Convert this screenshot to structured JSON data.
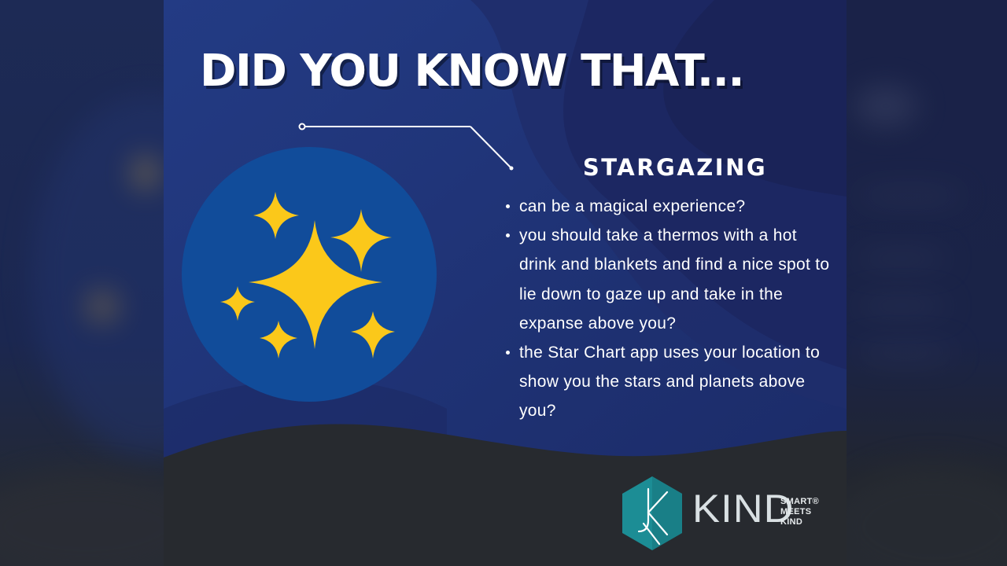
{
  "header": {
    "title": "DID YOU KNOW THAT..."
  },
  "topic": {
    "heading": "STARGAZING"
  },
  "facts": [
    "can be a magical experience?",
    "you should take a thermos with a hot drink and blankets and find a nice spot to lie down to gaze up and take in the expanse above you?",
    "the Star Chart app uses your location to show you the stars and planets above you?"
  ],
  "brand": {
    "name": "KIND",
    "tagline_line1": "SMART®",
    "tagline_line2": "MEETS",
    "tagline_line3": "KIND"
  },
  "colors": {
    "navy": "#1e2a5e",
    "navy_dark": "#1a2350",
    "circle_blue": "#114c9a",
    "star_yellow": "#fbc81a",
    "footer_charcoal": "#272a2f",
    "logo_teal": "#1c8d95",
    "text_white": "#ffffff"
  },
  "icons": {
    "illustration": "sparkle-stars-icon",
    "logo": "kind-hexagon-logo-icon"
  }
}
